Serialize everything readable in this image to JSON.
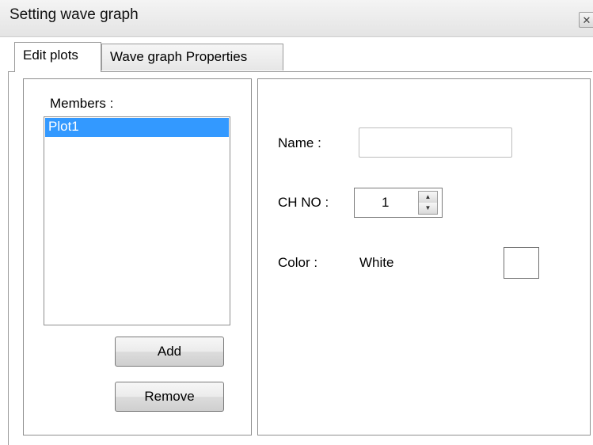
{
  "window": {
    "title": "Setting wave graph",
    "close_glyph": "✕"
  },
  "tabs": [
    {
      "label": "Edit plots",
      "active": true
    },
    {
      "label": "Wave graph Properties",
      "active": false
    }
  ],
  "members": {
    "label": "Members :",
    "items": [
      "Plot1"
    ],
    "selected": "Plot1",
    "add_label": "Add",
    "remove_label": "Remove"
  },
  "properties": {
    "name_label": "Name :",
    "name_value": "",
    "ch_label": "CH NO :",
    "ch_value": "1",
    "color_label": "Color :",
    "color_name": "White",
    "color_hex": "#ffffff"
  },
  "colors": {
    "selection": "#3399ff",
    "border": "#8e8e8e"
  },
  "icons": {
    "close": "close-icon",
    "spin_up": "chevron-up-icon",
    "spin_down": "chevron-down-icon"
  }
}
